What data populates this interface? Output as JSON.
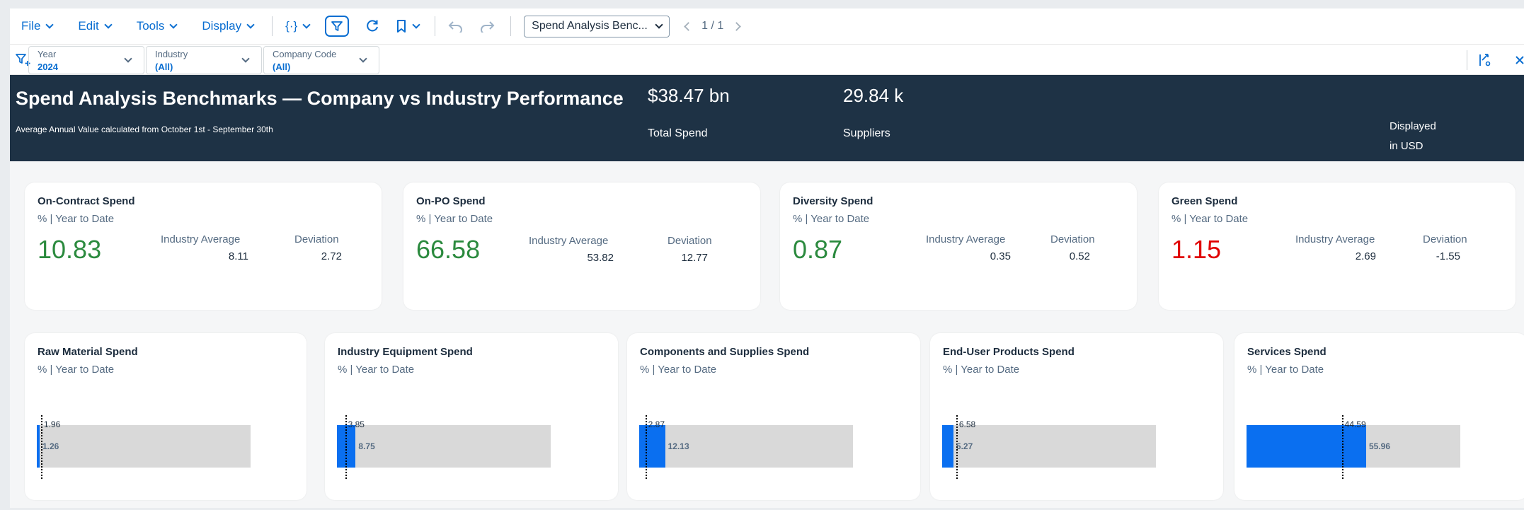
{
  "toolbar": {
    "menus": [
      "File",
      "Edit",
      "Tools",
      "Display"
    ],
    "code_label": "{·}",
    "story_select": "Spend Analysis Benc...",
    "pager": "1 / 1"
  },
  "filters": [
    {
      "label": "Year",
      "value": "2024"
    },
    {
      "label": "Industry",
      "value": "(All)"
    },
    {
      "label": "Company Code",
      "value": "(All)"
    }
  ],
  "banner": {
    "title": "Spend Analysis Benchmarks — Company vs Industry Performance",
    "subtitle": "Average Annual Value calculated from October 1st - September 30th",
    "total_spend_value": "$38.47 bn",
    "total_spend_label": "Total Spend",
    "suppliers_value": "29.84 k",
    "suppliers_label": "Suppliers",
    "displayed_line1": "Displayed",
    "displayed_line2": "in USD"
  },
  "kpi_cards": [
    {
      "title": "On-Contract Spend",
      "subtitle": "% | Year to Date",
      "value": "10.83",
      "avg_label": "Industry Average",
      "avg": "8.11",
      "dev_label": "Deviation",
      "dev": "2.72",
      "status": "good"
    },
    {
      "title": "On-PO Spend",
      "subtitle": "% | Year to Date",
      "value": "66.58",
      "avg_label": "Industry Average",
      "avg": "53.82",
      "dev_label": "Deviation",
      "dev": "12.77",
      "status": "good"
    },
    {
      "title": "Diversity Spend",
      "subtitle": "% | Year to Date",
      "value": "0.87",
      "avg_label": "Industry Average",
      "avg": "0.35",
      "dev_label": "Deviation",
      "dev": "0.52",
      "status": "good"
    },
    {
      "title": "Green Spend",
      "subtitle": "% | Year to Date",
      "value": "1.15",
      "avg_label": "Industry Average",
      "avg": "2.69",
      "dev_label": "Deviation",
      "dev": "-1.55",
      "status": "bad"
    }
  ],
  "bar_cards": [
    {
      "title": "Raw Material Spend",
      "subtitle": "% | Year to Date",
      "actual": 1.26,
      "actual_label": "1.26",
      "benchmark": 1.96,
      "benchmark_label": "1.96",
      "scale_max": 100
    },
    {
      "title": "Industry Equipment Spend",
      "subtitle": "% | Year to Date",
      "actual": 8.75,
      "actual_label": "8.75",
      "benchmark": 3.85,
      "benchmark_label": "3.85",
      "scale_max": 100
    },
    {
      "title": "Components and Supplies Spend",
      "subtitle": "% | Year to Date",
      "actual": 12.13,
      "actual_label": "12.13",
      "benchmark": 2.87,
      "benchmark_label": "2.87",
      "scale_max": 100
    },
    {
      "title": "End-User Products Spend",
      "subtitle": "% | Year to Date",
      "actual": 5.27,
      "actual_label": "5.27",
      "benchmark": 6.58,
      "benchmark_label": "6.58",
      "scale_max": 100
    },
    {
      "title": "Services Spend",
      "subtitle": "% | Year to Date",
      "actual": 55.96,
      "actual_label": "55.96",
      "benchmark": 44.59,
      "benchmark_label": "44.59",
      "scale_max": 100
    }
  ],
  "colors": {
    "accent": "#0a6ed1",
    "banner": "#1e3245",
    "good": "#2b8a3e",
    "bad": "#e00000",
    "bar": "#0a6ff0",
    "track": "#d9d9d9"
  },
  "icons": [
    "filter-icon",
    "refresh-icon",
    "bookmark-icon",
    "undo-icon",
    "redo-icon",
    "add-filter-icon",
    "linked-analysis-icon",
    "close-icon"
  ]
}
